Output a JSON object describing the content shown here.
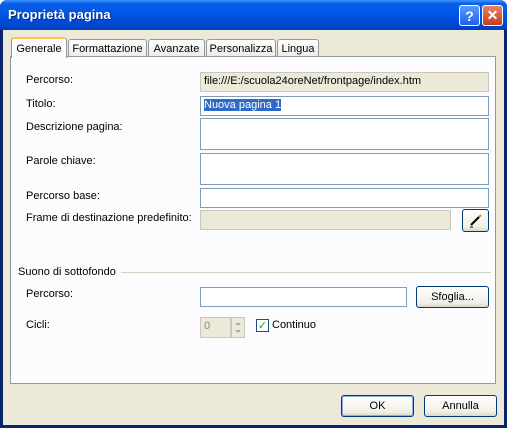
{
  "window": {
    "title": "Proprietà pagina",
    "help_glyph": "?",
    "close_glyph": "✕"
  },
  "tabs": [
    {
      "label": "Generale",
      "active": true
    },
    {
      "label": "Formattazione",
      "active": false
    },
    {
      "label": "Avanzate",
      "active": false
    },
    {
      "label": "Personalizza",
      "active": false
    },
    {
      "label": "Lingua",
      "active": false
    }
  ],
  "general": {
    "path_label": "Percorso:",
    "path_value": "file:///E:/scuola24oreNet/frontpage/index.htm",
    "title_label": "Titolo:",
    "title_value": "Nuova pagina 1",
    "description_label": "Descrizione pagina:",
    "description_value": "",
    "keywords_label": "Parole chiave:",
    "keywords_value": "",
    "base_label": "Percorso base:",
    "base_value": "",
    "frame_label": "Frame di destinazione predefinito:",
    "frame_value": "",
    "frame_button_icon": "pencil-icon"
  },
  "sound": {
    "section_label": "Suono di sottofondo",
    "path_label": "Percorso:",
    "path_value": "",
    "browse_label": "Sfoglia...",
    "loops_label": "Cicli:",
    "loops_value": "0",
    "continuous_label": "Continuo",
    "continuous_checked": true
  },
  "footer": {
    "ok_label": "OK",
    "cancel_label": "Annulla"
  }
}
